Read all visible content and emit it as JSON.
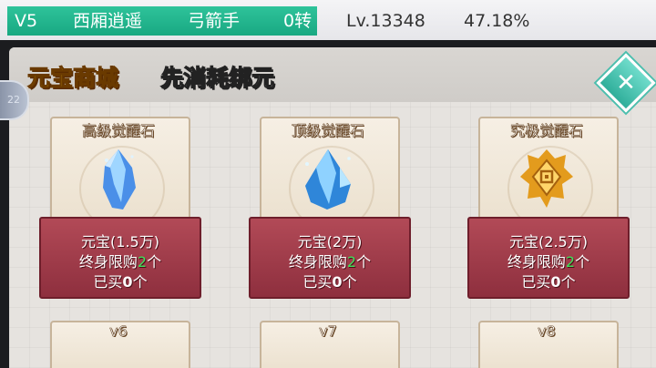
{
  "status": {
    "vip": "V5",
    "server": "西厢逍遥",
    "class": "弓箭手",
    "rebirth": "0转",
    "level": "Lv.13348",
    "exp_percent": "47.18%"
  },
  "header": {
    "title": "元宝商城",
    "subtitle": "先消耗绑元"
  },
  "side_tab": {
    "label": "22"
  },
  "labels": {
    "limit_prefix": "终身限购",
    "limit_suffix": "个",
    "bought_prefix": "已买",
    "bought_suffix": "个"
  },
  "items": [
    {
      "name": "高级觉醒石",
      "price": "元宝(1.5万)",
      "limit": "2",
      "bought": "0",
      "icon": "blue-crystal-icon",
      "color": "#6ab8ff"
    },
    {
      "name": "顶级觉醒石",
      "price": "元宝(2万)",
      "limit": "2",
      "bought": "0",
      "icon": "ice-crystal-icon",
      "color": "#5fc4ff"
    },
    {
      "name": "究极觉醒石",
      "price": "元宝(2.5万)",
      "limit": "2",
      "bought": "0",
      "icon": "gold-rune-icon",
      "color": "#f3b531"
    }
  ],
  "next_items": [
    {
      "name": "v6"
    },
    {
      "name": "v7"
    },
    {
      "name": "v8"
    }
  ]
}
